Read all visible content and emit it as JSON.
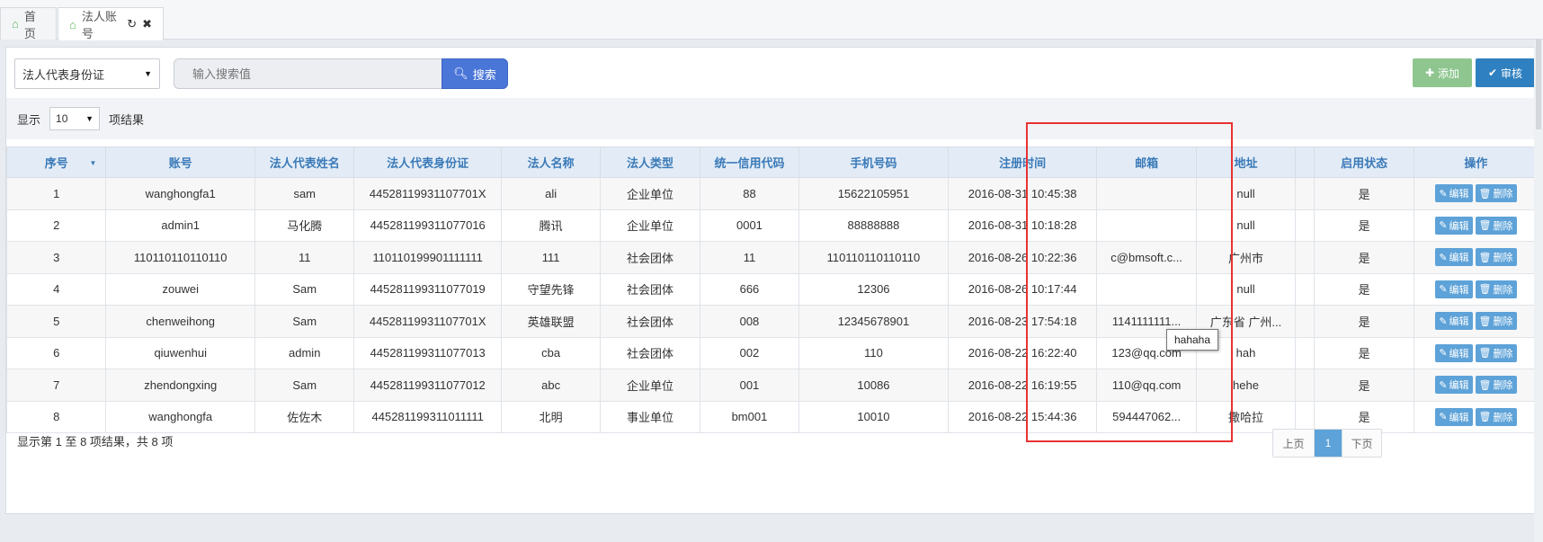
{
  "tabs": [
    {
      "label": "首页",
      "icon": "home-icon"
    },
    {
      "label": "法人账号",
      "icon": "home-icon",
      "active": true
    }
  ],
  "toolbar": {
    "field_select": "法人代表身份证",
    "search_placeholder": "输入搜索值",
    "search_label": "搜索",
    "add_label": "添加",
    "audit_label": "审核"
  },
  "filter": {
    "show_label": "显示",
    "page_size": "10",
    "result_label": "项结果"
  },
  "table": {
    "columns": [
      "序号",
      "账号",
      "法人代表姓名",
      "法人代表身份证",
      "法人名称",
      "法人类型",
      "统一信用代码",
      "手机号码",
      "注册时间",
      "邮箱",
      "地址",
      "",
      "启用状态",
      "操作"
    ],
    "rows": [
      {
        "no": "1",
        "account": "wanghongfa1",
        "rep_name": "sam",
        "rep_id": "44528119931107701X",
        "name": "ali",
        "type": "企业单位",
        "credit": "88",
        "phone": "15622105951",
        "time": "2016-08-31 10:45:38",
        "email": "",
        "address": "null",
        "status": "是"
      },
      {
        "no": "2",
        "account": "admin1",
        "rep_name": "马化腾",
        "rep_id": "445281199311077016",
        "name": "腾讯",
        "type": "企业单位",
        "credit": "0001",
        "phone": "88888888",
        "time": "2016-08-31 10:18:28",
        "email": "",
        "address": "null",
        "status": "是"
      },
      {
        "no": "3",
        "account": "110110110110110",
        "rep_name": "11",
        "rep_id": "110110199901111111",
        "name": "111",
        "type": "社会团体",
        "credit": "11",
        "phone": "110110110110110",
        "time": "2016-08-26 10:22:36",
        "email": "c@bmsoft.c...",
        "address": "广州市",
        "status": "是"
      },
      {
        "no": "4",
        "account": "zouwei",
        "rep_name": "Sam",
        "rep_id": "445281199311077019",
        "name": "守望先锋",
        "type": "社会团体",
        "credit": "666",
        "phone": "12306",
        "time": "2016-08-26 10:17:44",
        "email": "",
        "address": "null",
        "status": "是"
      },
      {
        "no": "5",
        "account": "chenweihong",
        "rep_name": "Sam",
        "rep_id": "44528119931107701X",
        "name": "英雄联盟",
        "type": "社会团体",
        "credit": "008",
        "phone": "12345678901",
        "time": "2016-08-23 17:54:18",
        "email": "1141111111...",
        "address": "广东省 广州...",
        "status": "是"
      },
      {
        "no": "6",
        "account": "qiuwenhui",
        "rep_name": "admin",
        "rep_id": "445281199311077013",
        "name": "cba",
        "type": "社会团体",
        "credit": "002",
        "phone": "110",
        "time": "2016-08-22 16:22:40",
        "email": "123@qq.com",
        "address": "hah",
        "status": "是"
      },
      {
        "no": "7",
        "account": "zhendongxing",
        "rep_name": "Sam",
        "rep_id": "445281199311077012",
        "name": "abc",
        "type": "企业单位",
        "credit": "001",
        "phone": "10086",
        "time": "2016-08-22 16:19:55",
        "email": "110@qq.com",
        "address": "hehe",
        "status": "是"
      },
      {
        "no": "8",
        "account": "wanghongfa",
        "rep_name": "佐佐木",
        "rep_id": "445281199311011111",
        "name": "北明",
        "type": "事业单位",
        "credit": "bm001",
        "phone": "10010",
        "time": "2016-08-22 15:44:36",
        "email": "594447062...",
        "address": "撒哈拉",
        "status": "是"
      }
    ],
    "actions": {
      "edit": "编辑",
      "delete": "删除"
    }
  },
  "footer": {
    "info": "显示第 1 至 8 项结果，共 8 项",
    "prev": "上页",
    "current": "1",
    "next": "下页"
  },
  "tooltip": "hahaha",
  "colors": {
    "header_text": "#3a7ab8",
    "search_button": "#4a76d8",
    "add_button": "#8fc68f",
    "audit_button": "#2f80c0",
    "action_button": "#5da2d8",
    "highlight": "#e83232"
  }
}
